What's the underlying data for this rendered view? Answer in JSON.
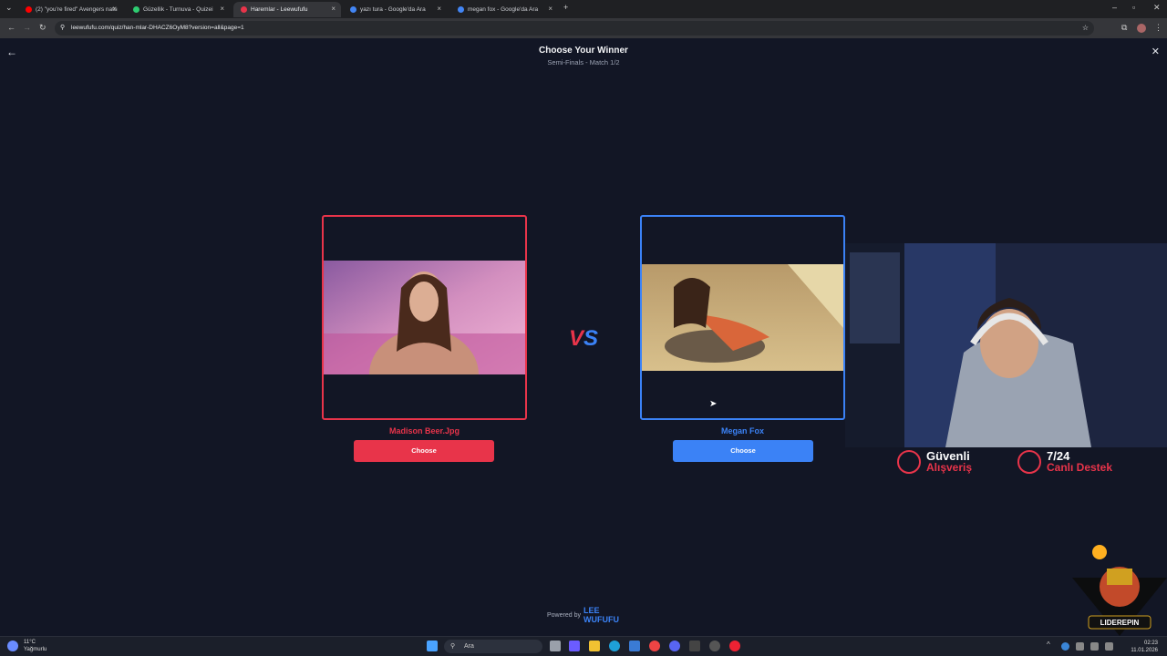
{
  "browser": {
    "tabs": [
      {
        "label": "(2) \"you're fired\" Avengers natu",
        "favicon_color": "#ff0000",
        "active": false
      },
      {
        "label": "Güzellik - Turnuva - Quizei",
        "favicon_color": "#2ecc71",
        "active": false
      },
      {
        "label": "Haremlar - Leewufufu",
        "favicon_color": "#e8344a",
        "active": true
      },
      {
        "label": "yazı tura - Google'da Ara",
        "favicon_color": "#4285f4",
        "active": false
      },
      {
        "label": "megan fox - Google'da Ara",
        "favicon_color": "#4285f4",
        "active": false
      }
    ],
    "url": "leewufufu.com/quiz/han-mlar-DHACZ6OyM8?version=all&page=1"
  },
  "header": {
    "title": "Choose Your Winner",
    "subtitle": "Semi-Finals - Match 1/2"
  },
  "contestants": {
    "left": {
      "name": "Madison Beer.Jpg",
      "button": "Choose",
      "color": "#e8344a"
    },
    "right": {
      "name": "Megan Fox",
      "button": "Choose",
      "color": "#3b82f6"
    }
  },
  "vs": {
    "v": "V",
    "s": "S"
  },
  "footer": {
    "powered_by": "Powered by",
    "logo_line1": "LEE",
    "logo_line2": "WUFUFU"
  },
  "stream_overlay": {
    "badge1_line1": "Güvenli",
    "badge1_line2": "Alışveriş",
    "badge2_line1": "7/24",
    "badge2_line2": "Canlı Destek",
    "mascot_label": "LIDEREPIN"
  },
  "taskbar": {
    "weather_temp": "11°C",
    "weather_desc": "Yağmurlu",
    "search_placeholder": "Ara",
    "time": "02:23",
    "date": "11.01.2026"
  }
}
